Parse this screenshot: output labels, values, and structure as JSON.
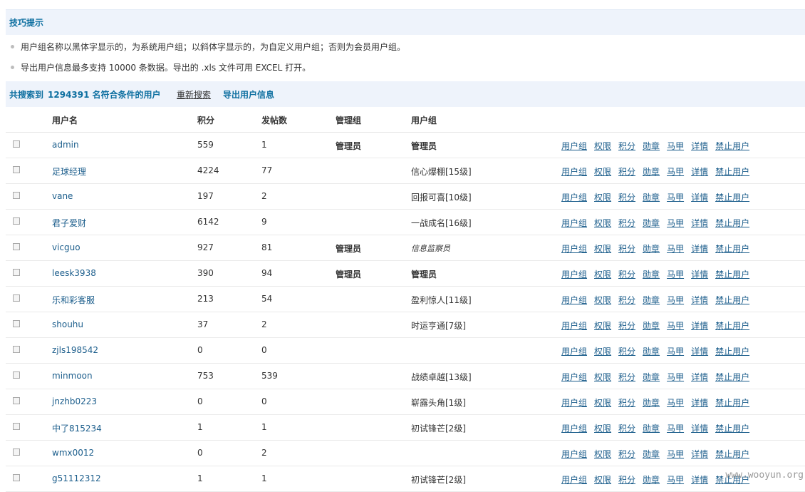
{
  "tips": {
    "title": "技巧提示",
    "items": [
      "用户组名称以黑体字显示的，为系统用户组；以斜体字显示的，为自定义用户组；否则为会员用户组。",
      "导出用户信息最多支持  10000 条数据。导出的  .xls 文件可用  EXCEL 打开。"
    ]
  },
  "search": {
    "prefix": "共搜索到",
    "count": "1294391",
    "suffix": "名符合条件的用户",
    "research_label": "重新搜索",
    "export_label": "导出用户信息"
  },
  "table": {
    "headers": {
      "username": "用户名",
      "credits": "积分",
      "posts": "发帖数",
      "admin_group": "管理组",
      "user_group": "用户组"
    },
    "actions": [
      "用户组",
      "权限",
      "积分",
      "勋章",
      "马甲",
      "详情",
      "禁止用户"
    ],
    "rows": [
      {
        "username": "admin",
        "credits": "559",
        "posts": "1",
        "admin_group": "管理员",
        "user_group": "管理员",
        "style": "bold"
      },
      {
        "username": "足球经理",
        "credits": "4224",
        "posts": "77",
        "admin_group": "",
        "user_group": "信心爆棚[15级]",
        "style": ""
      },
      {
        "username": "vane",
        "credits": "197",
        "posts": "2",
        "admin_group": "",
        "user_group": "回报可喜[10级]",
        "style": ""
      },
      {
        "username": "君子爱财",
        "credits": "6142",
        "posts": "9",
        "admin_group": "",
        "user_group": "一战成名[16级]",
        "style": ""
      },
      {
        "username": "vicguo",
        "credits": "927",
        "posts": "81",
        "admin_group": "管理员",
        "user_group": "信息监察员",
        "style": "italic"
      },
      {
        "username": "leesk3938",
        "credits": "390",
        "posts": "94",
        "admin_group": "管理员",
        "user_group": "管理员",
        "style": "bold"
      },
      {
        "username": "乐和彩客服",
        "credits": "213",
        "posts": "54",
        "admin_group": "",
        "user_group": "盈利惊人[11级]",
        "style": ""
      },
      {
        "username": "shouhu",
        "credits": "37",
        "posts": "2",
        "admin_group": "",
        "user_group": "时运亨通[7级]",
        "style": ""
      },
      {
        "username": "zjls198542",
        "credits": "0",
        "posts": "0",
        "admin_group": "",
        "user_group": "",
        "style": ""
      },
      {
        "username": "minmoon",
        "credits": "753",
        "posts": "539",
        "admin_group": "",
        "user_group": "战绩卓越[13级]",
        "style": ""
      },
      {
        "username": "jnzhb0223",
        "credits": "0",
        "posts": "0",
        "admin_group": "",
        "user_group": "崭露头角[1级]",
        "style": ""
      },
      {
        "username": "中了815234",
        "credits": "1",
        "posts": "1",
        "admin_group": "",
        "user_group": "初试锋芒[2级]",
        "style": ""
      },
      {
        "username": "wmx0012",
        "credits": "0",
        "posts": "2",
        "admin_group": "",
        "user_group": "",
        "style": ""
      },
      {
        "username": "g51112312",
        "credits": "1",
        "posts": "1",
        "admin_group": "",
        "user_group": "初试锋芒[2级]",
        "style": ""
      }
    ]
  },
  "watermark": "www.wooyun.org"
}
